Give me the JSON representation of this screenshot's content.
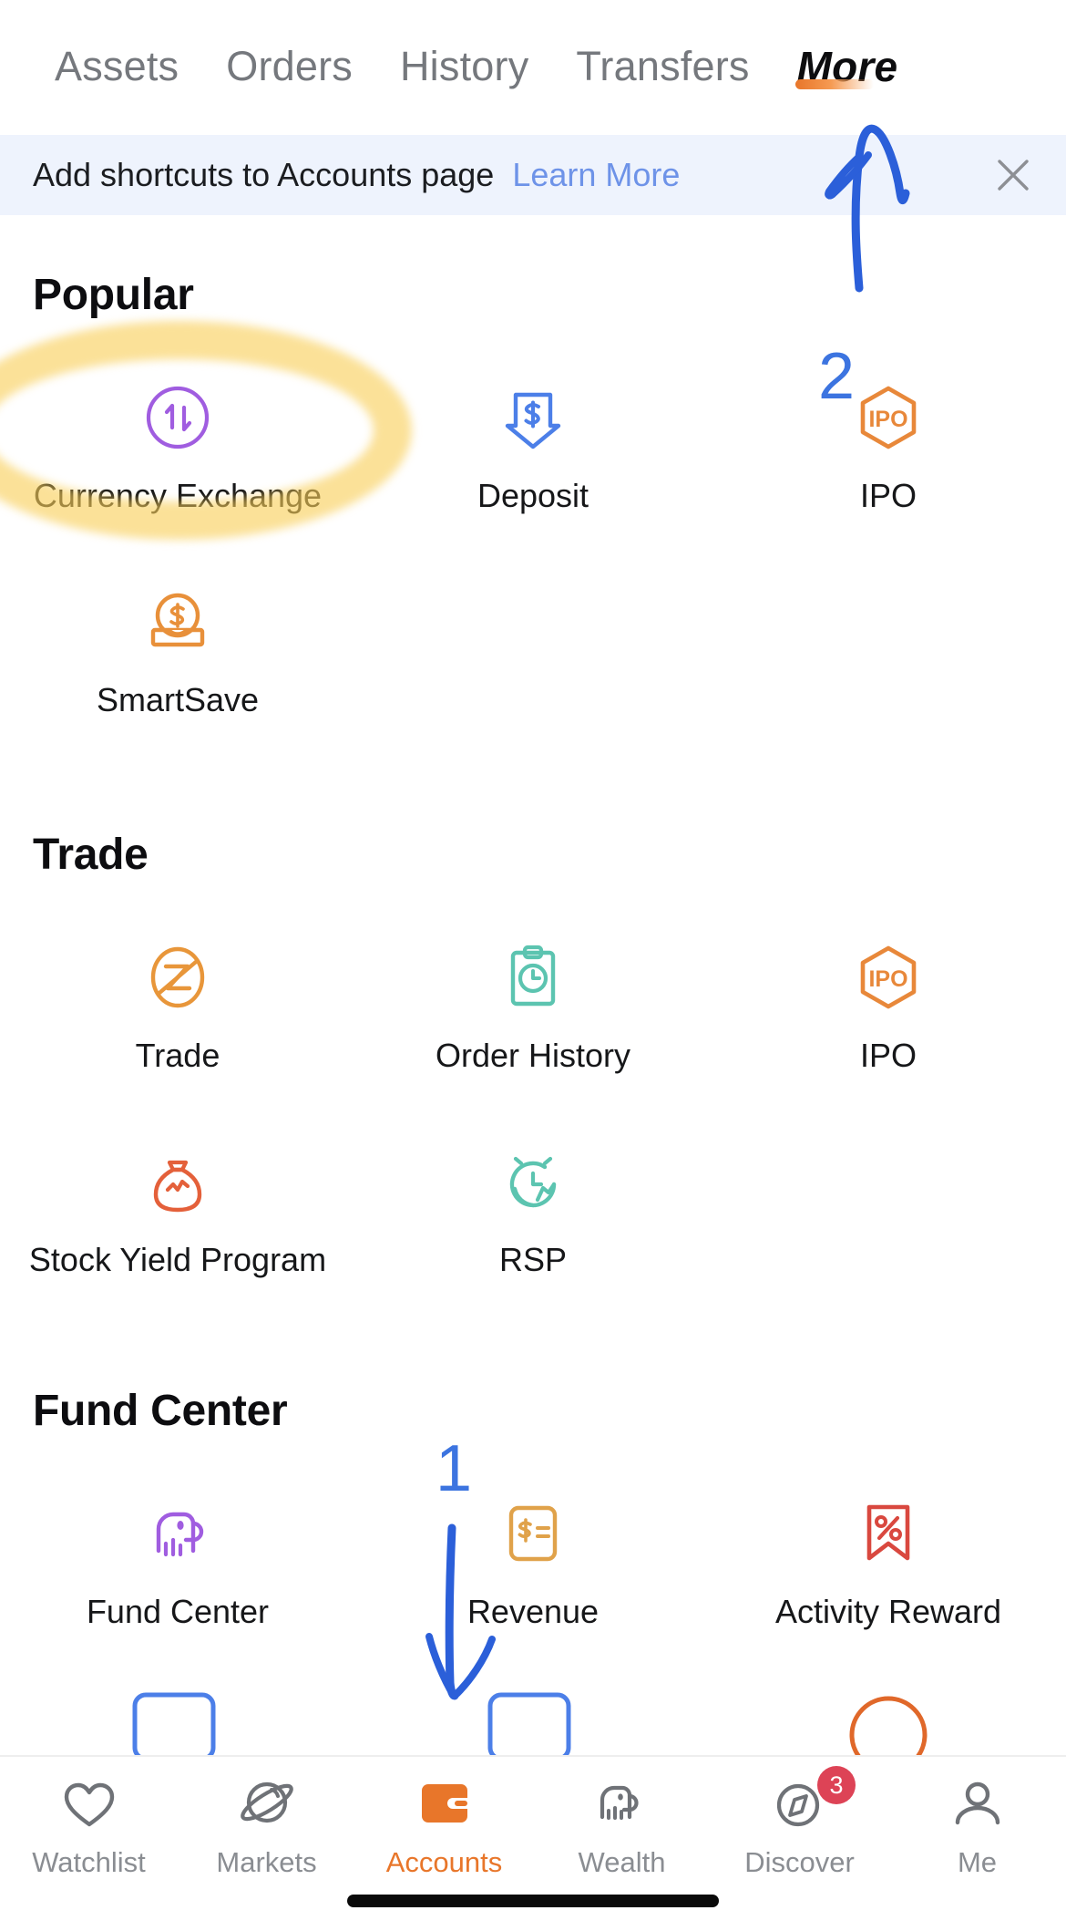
{
  "top_tabs": [
    {
      "label": "Assets",
      "active": false
    },
    {
      "label": "Orders",
      "active": false
    },
    {
      "label": "History",
      "active": false
    },
    {
      "label": "Transfers",
      "active": false
    },
    {
      "label": "More",
      "active": true
    }
  ],
  "banner": {
    "text": "Add shortcuts to Accounts page",
    "link_label": "Learn More",
    "close_icon": "close-icon",
    "background_color": "#eef3fd",
    "link_color": "#6e93e8"
  },
  "sections": [
    {
      "title": "Popular",
      "tiles": [
        {
          "label": "Currency Exchange",
          "icon": "currency-exchange-icon",
          "color": "#a05de0"
        },
        {
          "label": "Deposit",
          "icon": "deposit-arrow-icon",
          "color": "#4c7fe8"
        },
        {
          "label": "IPO",
          "icon": "ipo-hexagon-icon",
          "color": "#e8883a"
        },
        {
          "label": "SmartSave",
          "icon": "smartsave-coin-icon",
          "color": "#e8903a"
        }
      ]
    },
    {
      "title": "Trade",
      "tiles": [
        {
          "label": "Trade",
          "icon": "trade-z-icon",
          "color": "#e8963a"
        },
        {
          "label": "Order History",
          "icon": "order-history-icon",
          "color": "#5cc4b0"
        },
        {
          "label": "IPO",
          "icon": "ipo-hexagon-icon",
          "color": "#e8883a"
        },
        {
          "label": "Stock Yield Program",
          "icon": "money-bag-chart-icon",
          "color": "#e4603a"
        },
        {
          "label": "RSP",
          "icon": "alarm-clock-icon",
          "color": "#5cc4b0"
        }
      ]
    },
    {
      "title": "Fund Center",
      "tiles": [
        {
          "label": "Fund Center",
          "icon": "elephant-chart-icon",
          "color": "#a05de0"
        },
        {
          "label": "Revenue",
          "icon": "revenue-card-icon",
          "color": "#e0a24a"
        },
        {
          "label": "Activity Reward",
          "icon": "percent-ribbon-icon",
          "color": "#d9483f"
        }
      ]
    }
  ],
  "annotations": {
    "highlight_color": "#f8ce59",
    "ink_color": "#3c74e0",
    "marks": [
      {
        "name": "arrow-to-more-tab",
        "number": "2",
        "target": "More tab"
      },
      {
        "name": "arrow-to-bottom-nav",
        "number": "1",
        "target": "Accounts nav"
      }
    ]
  },
  "bottom_nav": [
    {
      "label": "Watchlist",
      "icon": "heart-icon",
      "active": false,
      "badge": ""
    },
    {
      "label": "Markets",
      "icon": "planet-icon",
      "active": false,
      "badge": ""
    },
    {
      "label": "Accounts",
      "icon": "wallet-icon",
      "active": true,
      "badge": ""
    },
    {
      "label": "Wealth",
      "icon": "elephant-icon",
      "active": false,
      "badge": ""
    },
    {
      "label": "Discover",
      "icon": "compass-icon",
      "active": false,
      "badge": "3"
    },
    {
      "label": "Me",
      "icon": "person-icon",
      "active": false,
      "badge": ""
    }
  ],
  "accent_color": "#e8762a"
}
